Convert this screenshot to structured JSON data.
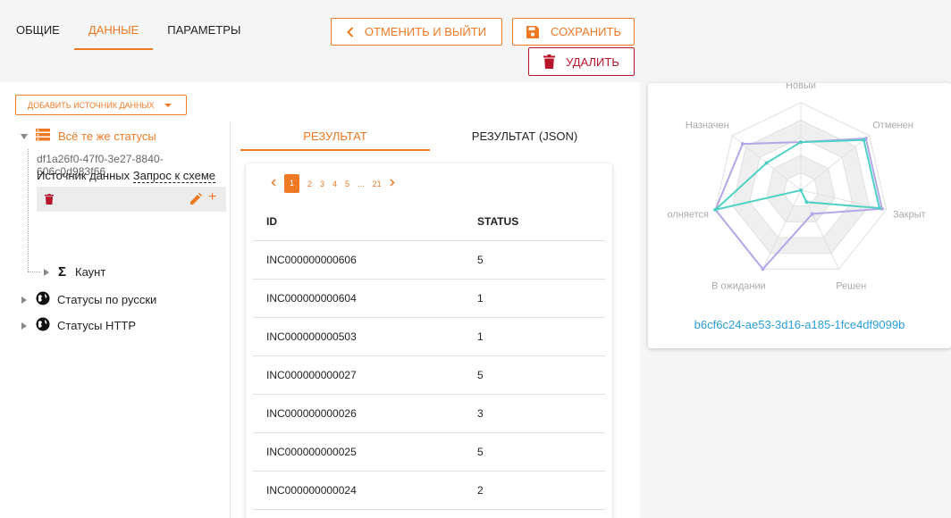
{
  "tabs": [
    "ОБЩИЕ",
    "ДАННЫЕ",
    "ПАРАМЕТРЫ"
  ],
  "buttons": {
    "cancel": "ОТМЕНИТЬ И ВЫЙТИ",
    "save": "СОХРАНИТЬ",
    "delete": "УДАЛИТЬ"
  },
  "add_source": "ДОБАВИТЬ ИСТОЧНИК ДАННЫХ",
  "tree": {
    "root_label": "Всё те же статусы",
    "uuid": "df1a26f0-47f0-3e27-8840-606c0d983f66",
    "source_prefix": "Источник данных",
    "source_link": "Запрос к схеме",
    "child_label": "Каунт",
    "nodes": [
      "Статусы по русски",
      "Статусы HTTP"
    ]
  },
  "result_tabs": [
    "РЕЗУЛЬТАТ",
    "РЕЗУЛЬТАТ (JSON)"
  ],
  "pager": [
    "1",
    "2",
    "3",
    "4",
    "5",
    "...",
    "21"
  ],
  "table": {
    "headers": [
      "ID",
      "STATUS"
    ],
    "rows": [
      [
        "INC000000000606",
        "5"
      ],
      [
        "INC000000000604",
        "1"
      ],
      [
        "INC000000000503",
        "1"
      ],
      [
        "INC000000000027",
        "5"
      ],
      [
        "INC000000000026",
        "3"
      ],
      [
        "INC000000000025",
        "5"
      ],
      [
        "INC000000000024",
        "2"
      ]
    ]
  },
  "chart_data": {
    "type": "radar",
    "axes": [
      "Новый",
      "Отменен",
      "Закрыт",
      "Решен",
      "В ожидании",
      "Выполняется",
      "Назначен"
    ],
    "axis_labels_visible": [
      "Новый",
      "Отменен",
      "Закрыт",
      "Решен",
      "В ожидании",
      "олняется",
      "Назначен"
    ],
    "rmax": 1,
    "series": [
      {
        "color": "#b3a7e8",
        "values": [
          0.55,
          0.95,
          0.95,
          0.3,
          1.0,
          1.0,
          0.85
        ]
      },
      {
        "color": "#4dd0c6",
        "values": [
          0.55,
          0.92,
          0.92,
          0.15,
          0.0,
          1.0,
          0.5
        ]
      }
    ],
    "id_label": "b6cf6c24-ae53-3d16-a185-1fce4df9099b"
  },
  "colors": {
    "accent": "#f07a24",
    "danger": "#b8142a",
    "link": "#2b9fd9"
  }
}
